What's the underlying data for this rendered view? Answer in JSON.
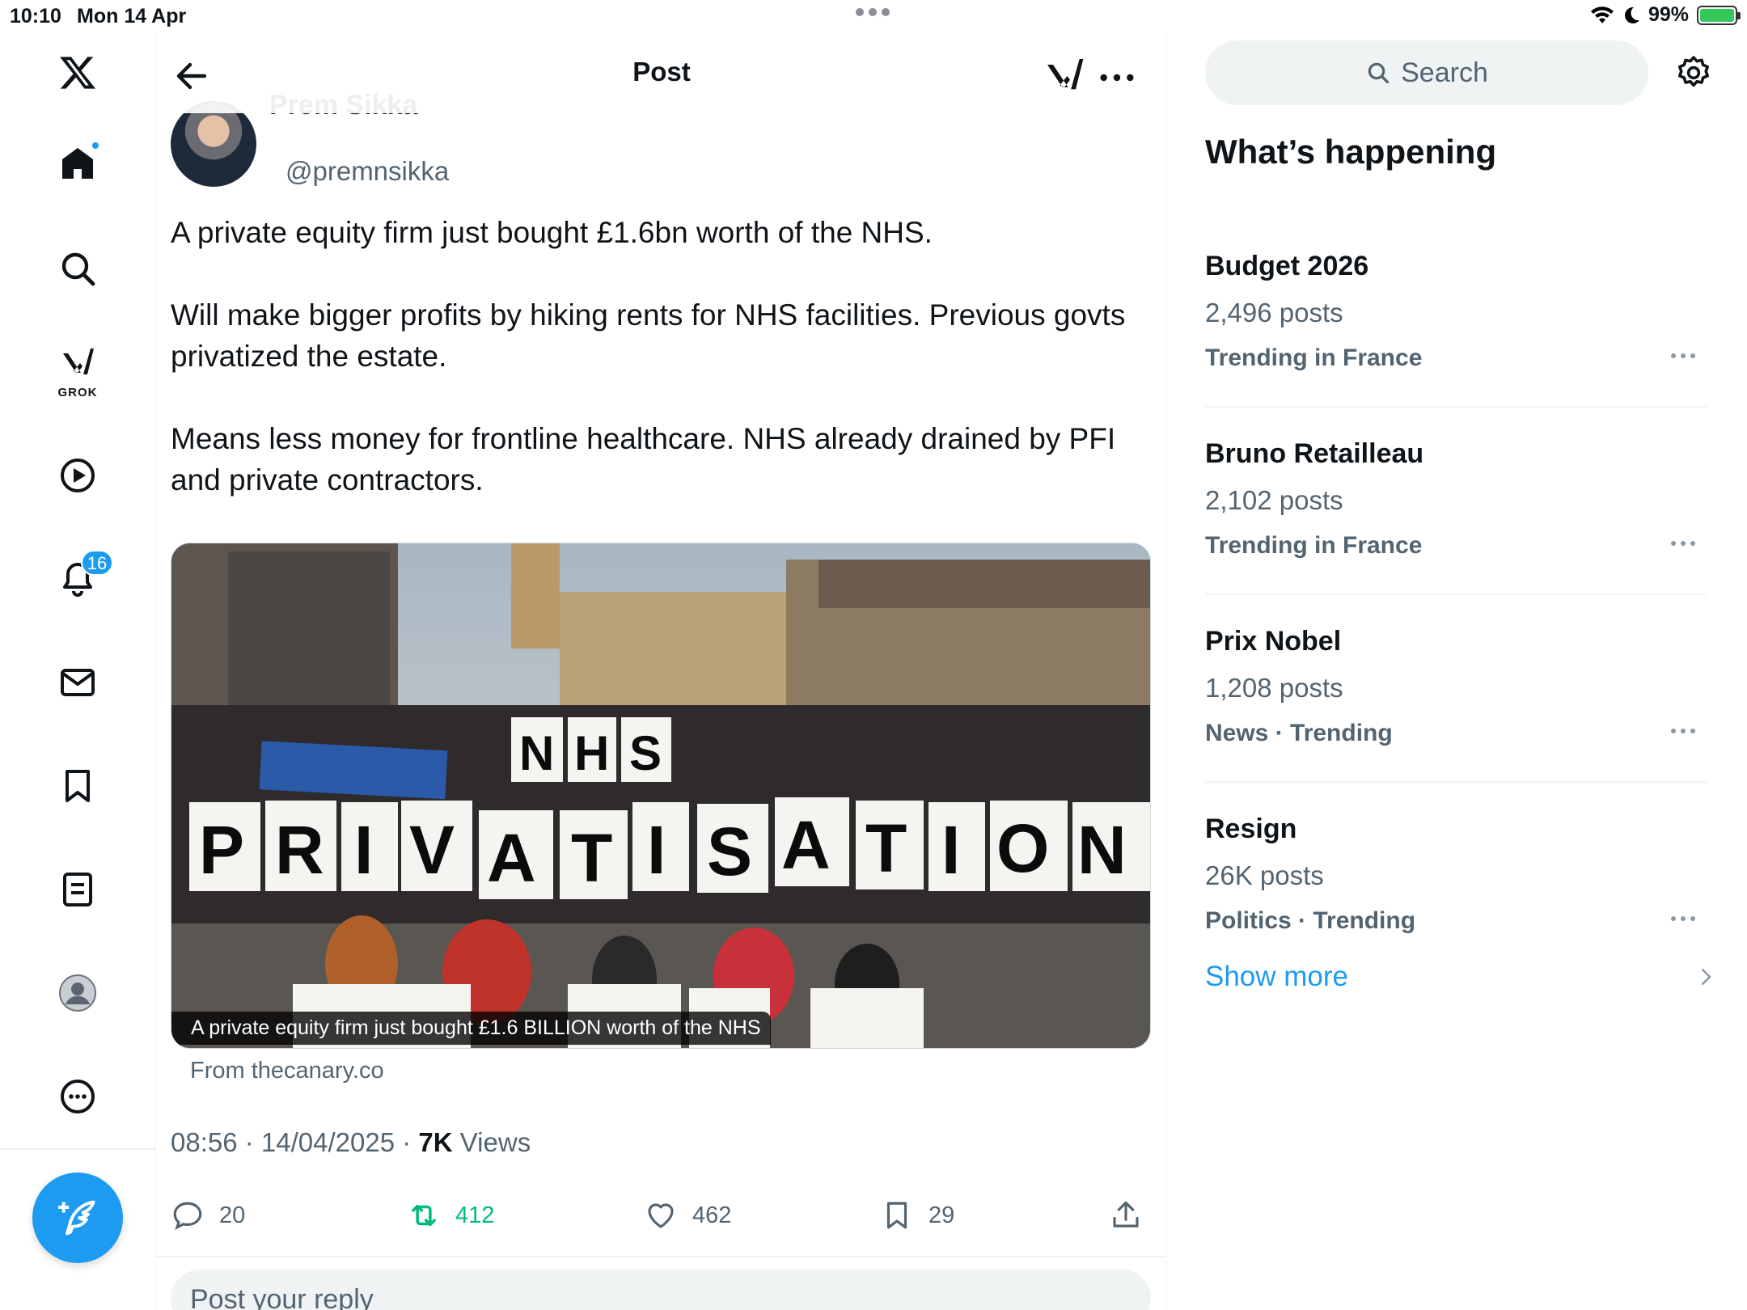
{
  "status_bar": {
    "time": "10:10",
    "date": "Mon 14 Apr",
    "battery": "99%"
  },
  "nav": {
    "grok_label": "GROK",
    "notifications_count": "16"
  },
  "header": {
    "title": "Post"
  },
  "post": {
    "author_name": "Prem Sikka",
    "handle": "@premnsikka",
    "paragraphs": [
      "A private equity firm just bought £1.6bn worth of the NHS.",
      "Will make bigger profits by hiking rents for NHS facilities. Previous govts privatized the estate.",
      "Means less money for frontline healthcare. NHS already drained by PFI and private contractors."
    ],
    "card": {
      "image_text_top": "NHS",
      "image_text_main": "PRIVATISATION",
      "caption": "A private equity firm just bought £1.6 BILLION worth of the NHS",
      "source": "From thecanary.co"
    },
    "timestamp": "08:56 · 14/04/2025 · ",
    "views_count": "7K",
    "views_label": " Views",
    "stats": {
      "replies": "20",
      "reposts": "412",
      "likes": "462",
      "bookmarks": "29"
    },
    "reply_placeholder": "Post your reply"
  },
  "sidebar": {
    "search_placeholder": "Search",
    "section_title": "What’s happening",
    "trends": [
      {
        "name": "Budget 2026",
        "count": "2,496 posts",
        "meta": "Trending in France"
      },
      {
        "name": "Bruno Retailleau",
        "count": "2,102 posts",
        "meta": "Trending in France"
      },
      {
        "name": "Prix Nobel",
        "count": "1,208 posts",
        "meta": "News · Trending"
      },
      {
        "name": "Resign",
        "count": "26K posts",
        "meta": "Politics · Trending"
      }
    ],
    "show_more": "Show more"
  },
  "colors": {
    "accent": "#1d9bf0",
    "repost": "#00ba7c",
    "secondary_text": "#536471"
  }
}
